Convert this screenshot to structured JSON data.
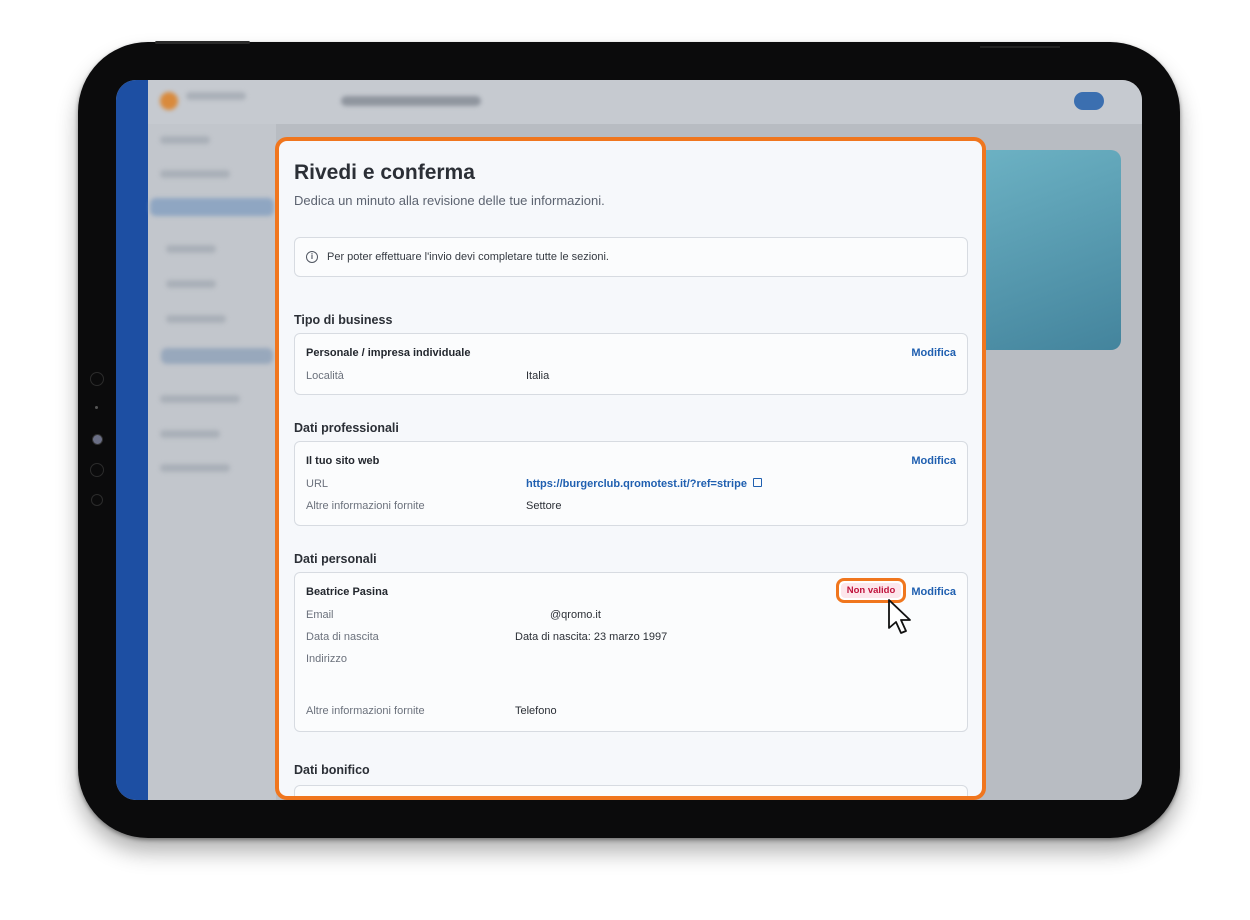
{
  "modal": {
    "title": "Rivedi e conferma",
    "subtitle": "Dedica un minuto alla revisione delle tue informazioni.",
    "notice": "Per poter effettuare l'invio devi completare tutte le sezioni."
  },
  "sections": {
    "business": {
      "title": "Tipo di business",
      "card_title": "Personale / impresa individuale",
      "edit_label": "Modifica",
      "rows": [
        {
          "label": "Località",
          "value": "Italia"
        }
      ]
    },
    "professional": {
      "title": "Dati professionali",
      "card_title": "Il tuo sito web",
      "edit_label": "Modifica",
      "url_label": "URL",
      "url_value": "https://burgerclub.qromotest.it/?ref=stripe",
      "other_label": "Altre informazioni fornite",
      "other_value": "Settore"
    },
    "personal": {
      "title": "Dati personali",
      "card_title": "Beatrice Pasina",
      "badge": "Non valido",
      "edit_label": "Modifica",
      "email_label": "Email",
      "email_value": "@qromo.it",
      "birth_label": "Data di nascita",
      "birth_value": "Data di nascita: 23 marzo 1997",
      "address_label": "Indirizzo",
      "other_label": "Altre informazioni fornite",
      "other_value": "Telefono"
    },
    "bank": {
      "title": "Dati bonifico"
    }
  },
  "icons": {
    "notice": "info-circle-icon",
    "external": "external-link-icon",
    "cursor": "mouse-pointer-icon"
  },
  "colors": {
    "accent": "#f0761e",
    "link": "#1f5fb0",
    "error": "#c0133d",
    "error_bg": "#fde6ec"
  }
}
